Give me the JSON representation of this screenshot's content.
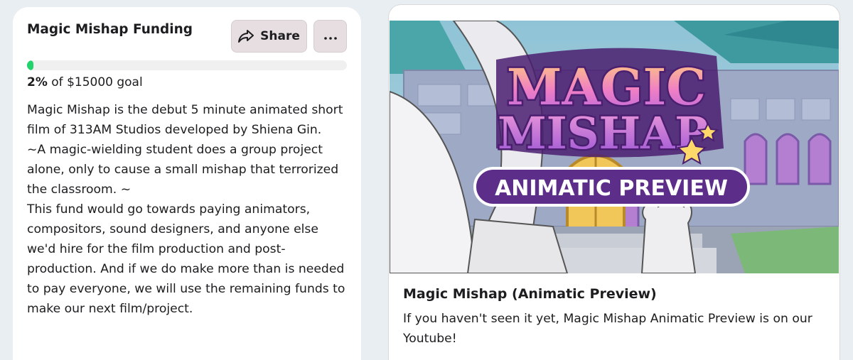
{
  "funding": {
    "title": "Magic Mishap Funding",
    "share_label": "Share",
    "more_label": "More options",
    "progress_fraction": 0.02,
    "percent": "2%",
    "goal_text": " of $15000 goal",
    "description": [
      "Magic Mishap is the debut 5 minute animated short film of 313AM Studios developed by Shiena Gin.",
      "~A magic-wielding student does a group project alone, only to cause a small mishap that terrorized the classroom. ~",
      "This fund would go towards paying animators, compositors, sound designers, and anyone else we'd hire for the film production and post-production. And if we do make more than is needed to pay everyone, we will use the remaining funds to make our next film/project."
    ]
  },
  "video": {
    "thumbnail": {
      "logo_line1": "MAGIC",
      "logo_line2": "MISHAP",
      "banner": "ANIMATIC PREVIEW"
    },
    "title": "Magic Mishap (Animatic Preview)",
    "description": "If you haven't seen it yet, Magic Mishap Animatic Preview is on our Youtube!"
  },
  "colors": {
    "progress": "#21d36b",
    "button_bg": "#e6dee0",
    "page_bg": "#e9eef3"
  },
  "icons": [
    "share-icon",
    "ellipsis-icon"
  ]
}
